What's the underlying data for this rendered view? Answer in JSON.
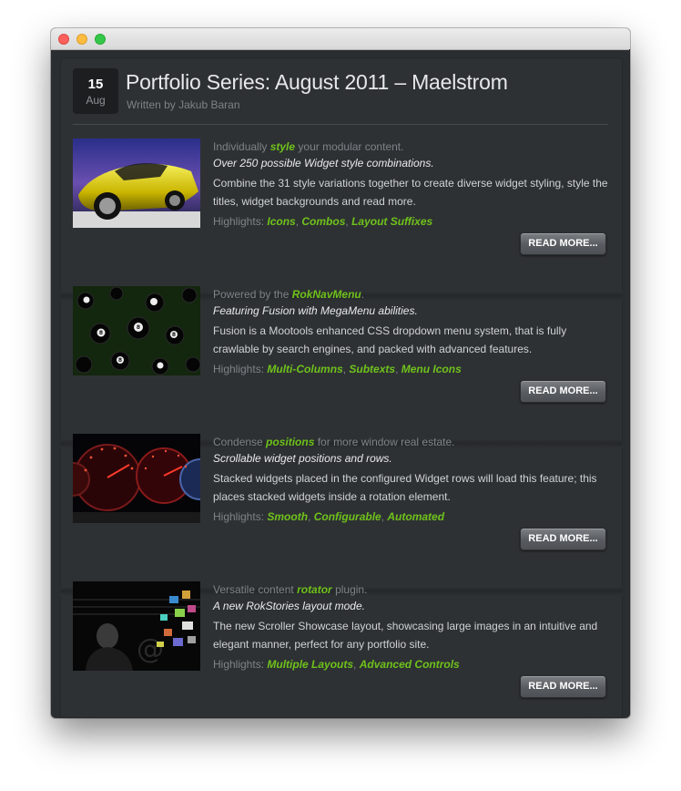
{
  "window": {
    "traffic_lights": [
      "close",
      "minimize",
      "zoom"
    ]
  },
  "post": {
    "date_day": "15",
    "date_month": "Aug",
    "title": "Portfolio Series: August 2011 – Maelstrom",
    "byline": "Written by Jakub Baran"
  },
  "items": [
    {
      "thumb": "yellow-car-image",
      "lead_before": "Individually ",
      "lead_em": "style",
      "lead_after": " your modular content.",
      "subtitle": "Over 250 possible Widget style combinations.",
      "description": "Combine the 31 style variations together to create diverse widget styling, style the titles, widget backgrounds and read more.",
      "highlights_label": "Highlights: ",
      "highlights": [
        "Icons",
        "Combos",
        "Layout Suffixes"
      ],
      "button": "READ MORE..."
    },
    {
      "thumb": "eight-balls-image",
      "lead_before": "Powered by the ",
      "lead_em": "RokNavMenu",
      "lead_after": ".",
      "subtitle": "Featuring Fusion with MegaMenu abilities.",
      "description": "Fusion is a Mootools enhanced CSS dropdown menu system, that is fully crawlable by search engines, and packed with advanced features.",
      "highlights_label": "Highlights: ",
      "highlights": [
        "Multi-Columns",
        "Subtexts",
        "Menu Icons"
      ],
      "button": "READ MORE..."
    },
    {
      "thumb": "speedometer-image",
      "lead_before": "Condense ",
      "lead_em": "positions",
      "lead_after": " for more window real estate.",
      "subtitle": "Scrollable widget positions and rows.",
      "description": "Stacked widgets placed in the configured Widget rows will load this feature; this places stacked widgets inside a rotation element.",
      "highlights_label": "Highlights: ",
      "highlights": [
        "Smooth",
        "Configurable",
        "Automated"
      ],
      "button": "READ MORE..."
    },
    {
      "thumb": "man-with-photos-image",
      "lead_before": "Versatile content ",
      "lead_em": "rotator",
      "lead_after": " plugin.",
      "subtitle": "A new RokStories layout mode.",
      "description": "The new Scroller Showcase layout, showcasing large images in an intuitive and elegant manner, perfect for any portfolio site.",
      "highlights_label": "Highlights: ",
      "highlights": [
        "Multiple Layouts",
        "Advanced Controls"
      ],
      "button": "READ MORE..."
    }
  ],
  "colors": {
    "background": "#2e3134",
    "accent_green": "#6fc21b",
    "muted_text": "#7d8388",
    "title_text": "#e6e8e9"
  }
}
